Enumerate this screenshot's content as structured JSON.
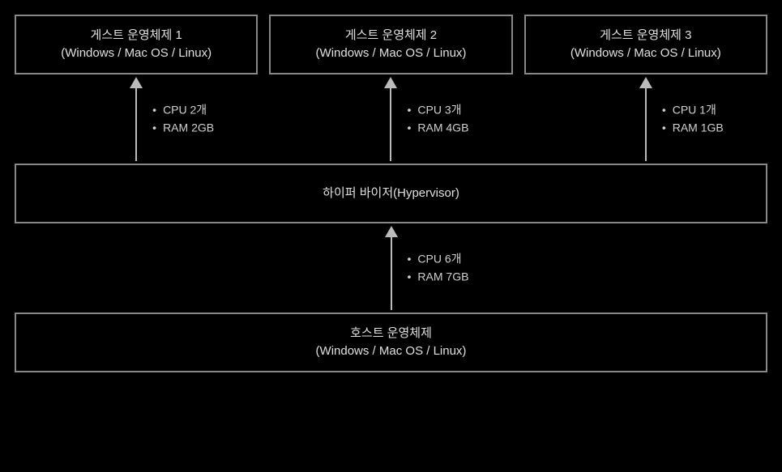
{
  "guests": [
    {
      "title": "게스트 운영체제 1",
      "sub": "(Windows / Mac OS / Linux)",
      "specs": [
        "CPU 2개",
        "RAM 2GB"
      ]
    },
    {
      "title": "게스트 운영체제 2",
      "sub": "(Windows / Mac OS / Linux)",
      "specs": [
        "CPU 3개",
        "RAM 4GB"
      ]
    },
    {
      "title": "게스트 운영체제 3",
      "sub": "(Windows / Mac OS / Linux)",
      "specs": [
        "CPU 1개",
        "RAM 1GB"
      ]
    }
  ],
  "hypervisor": {
    "title": "하이퍼 바이저(Hypervisor)"
  },
  "host_specs": [
    "CPU 6개",
    "RAM 7GB"
  ],
  "host": {
    "title": "호스트 운영체제",
    "sub": "(Windows / Mac OS / Linux)"
  }
}
